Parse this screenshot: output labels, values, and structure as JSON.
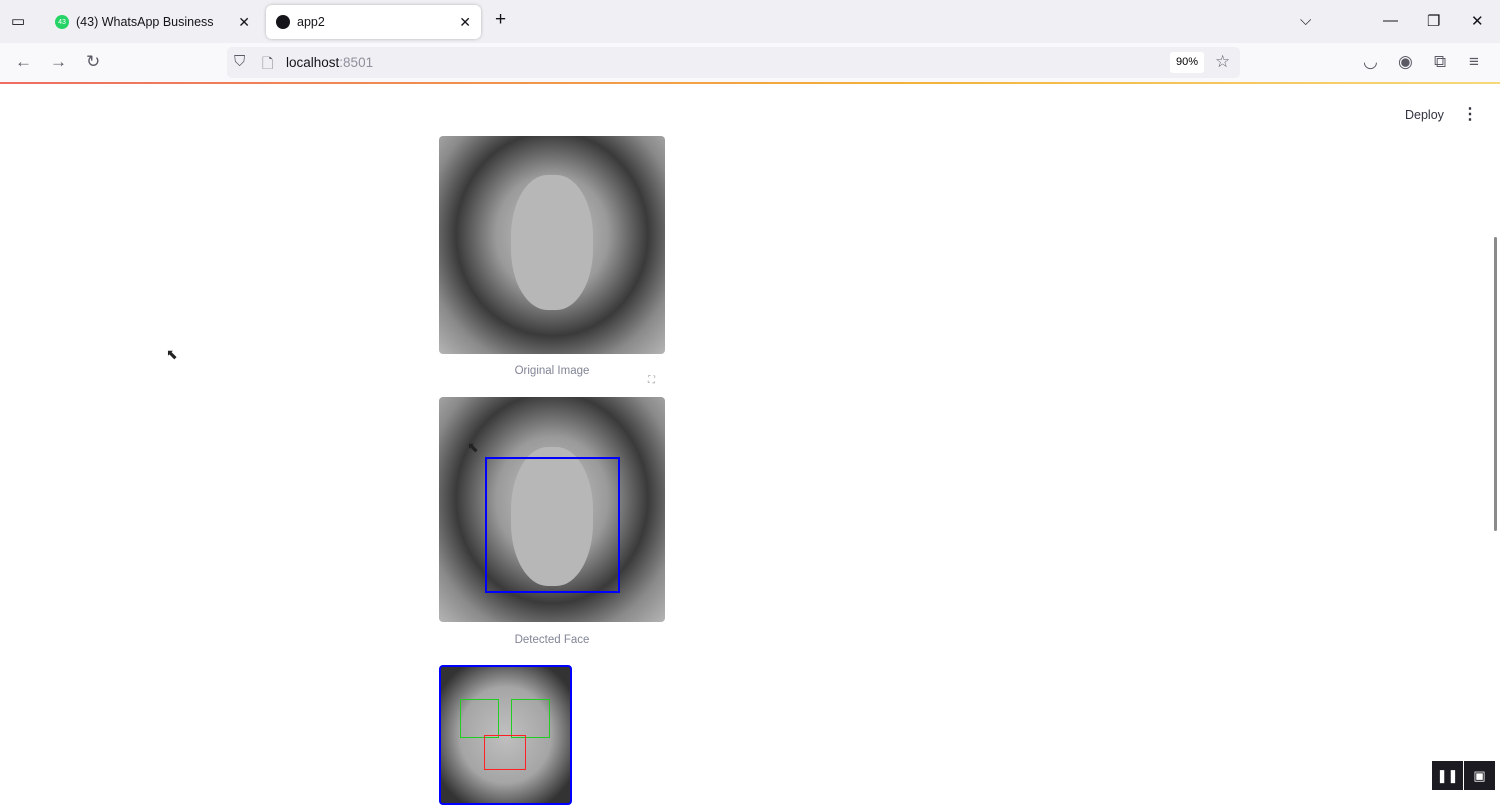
{
  "browser": {
    "tabs": [
      {
        "label": "(43) WhatsApp Business",
        "badge": "43",
        "active": false
      },
      {
        "label": "app2",
        "active": true
      }
    ],
    "url_host": "localhost",
    "url_port": ":8501",
    "zoom": "90%"
  },
  "app": {
    "deploy_label": "Deploy",
    "images": [
      {
        "caption": "Original Image"
      },
      {
        "caption": "Detected Face"
      },
      {
        "caption": ""
      }
    ]
  },
  "colors": {
    "face_box": "#0000ff",
    "eye_box": "#22cc22",
    "nose_box": "#ff2222"
  }
}
